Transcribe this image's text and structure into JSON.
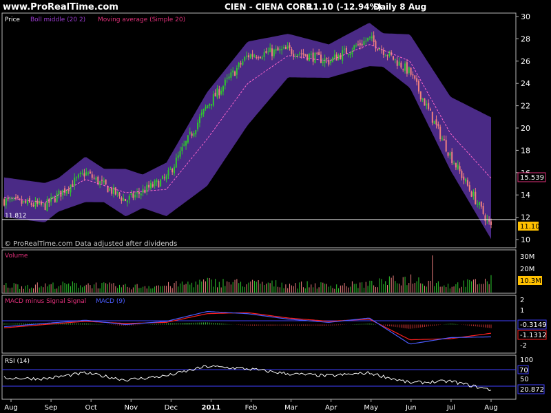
{
  "header": {
    "site": "www.ProRealTime.com",
    "symbol": "CIEN - CIENA CORP.",
    "quote": "11.10 (-12.94%)",
    "period": "Daily  8 Aug"
  },
  "colors": {
    "background": "#000000",
    "border": "#b8b8b8",
    "band": "#4a2a86",
    "up": "#2ec82e",
    "down": "#f08080",
    "ma": "#ff66cc",
    "axis_text": "#ffffff",
    "legend_text": "#c24ad8",
    "macd": "#4b5cff",
    "signal": "#ff2020",
    "hist_up": "#3fbf3f",
    "hist_down": "#c83232",
    "rsi": "#ffffff",
    "rsi_level": "#4040ff",
    "price_badge": "#ffc000",
    "watermark": "#d0d0d0"
  },
  "price_panel": {
    "legend": [
      "Price",
      "Boll middle (20 2)",
      "Moving average (Simple 20)"
    ],
    "min_label": "11.812",
    "watermark": "© ProRealTime.com  Data adjusted after dividends",
    "last_price": "11.10",
    "ma_value": "15.539",
    "y_ticks": [
      "30",
      "28",
      "26",
      "24",
      "22",
      "20",
      "18",
      "16",
      "14",
      "12",
      "10"
    ]
  },
  "volume_panel": {
    "title": "Volume",
    "y_ticks": [
      "30M",
      "20M"
    ],
    "last_value": "10.3M"
  },
  "macd_panel": {
    "title_main": "MACD minus Signal Signal",
    "title_macd": "MACD (9)",
    "y_ticks": [
      "2",
      "1",
      "-1",
      "-2"
    ],
    "value_hist": "-0.3149",
    "value_line": "-1.1312"
  },
  "rsi_panel": {
    "title": "RSI (14)",
    "y_ticks": [
      "100",
      "70",
      "50"
    ],
    "level_label": "70",
    "last_value": "20.872"
  },
  "time_axis": {
    "labels": [
      "Aug",
      "Sep",
      "Oct",
      "Nov",
      "Dec",
      "2011",
      "Feb",
      "Mar",
      "Apr",
      "May",
      "Jun",
      "Jul",
      "Aug"
    ]
  },
  "chart_data": {
    "type": "line",
    "title": "CIEN - CIENA CORP.",
    "x": [
      "Aug",
      "Sep",
      "Oct",
      "Nov",
      "Dec",
      "2011",
      "Feb",
      "Mar",
      "Apr",
      "May",
      "Jun",
      "Jul",
      "Aug"
    ],
    "xlabel": "",
    "ylabel": "",
    "ylim": [
      10,
      30
    ],
    "series": [
      {
        "name": "Price",
        "values": [
          13.5,
          13.0,
          16.0,
          13.5,
          15.5,
          22.0,
          26.5,
          27.0,
          26.0,
          28.0,
          25.0,
          17.5,
          11.1
        ]
      },
      {
        "name": "Moving average (Simple 20)",
        "values": [
          13.8,
          13.3,
          15.4,
          14.2,
          14.5,
          19.0,
          24.0,
          26.5,
          26.0,
          27.5,
          26.0,
          19.5,
          15.5
        ]
      }
    ],
    "volume": {
      "title": "Volume",
      "ylim": [
        0,
        35
      ],
      "unit": "M",
      "values": [
        6,
        6,
        7,
        5,
        6,
        9,
        8,
        7,
        6,
        7,
        12,
        6,
        10.3
      ]
    },
    "macd": {
      "ylim": [
        -2.5,
        2.5
      ],
      "macd": [
        -0.2,
        0.1,
        0.4,
        0.0,
        0.3,
        1.2,
        1.0,
        0.5,
        0.2,
        0.6,
        -1.8,
        -1.2,
        -1.1312
      ],
      "signal": [
        -0.3,
        0.0,
        0.3,
        0.1,
        0.2,
        1.0,
        1.1,
        0.6,
        0.3,
        0.5,
        -1.4,
        -1.3,
        -0.8
      ]
    },
    "rsi": {
      "ylim": [
        0,
        100
      ],
      "levels": [
        70,
        30
      ],
      "values": [
        50,
        48,
        62,
        45,
        55,
        78,
        72,
        60,
        55,
        62,
        38,
        42,
        20.872
      ]
    },
    "grid": false,
    "legend": "top-left"
  }
}
